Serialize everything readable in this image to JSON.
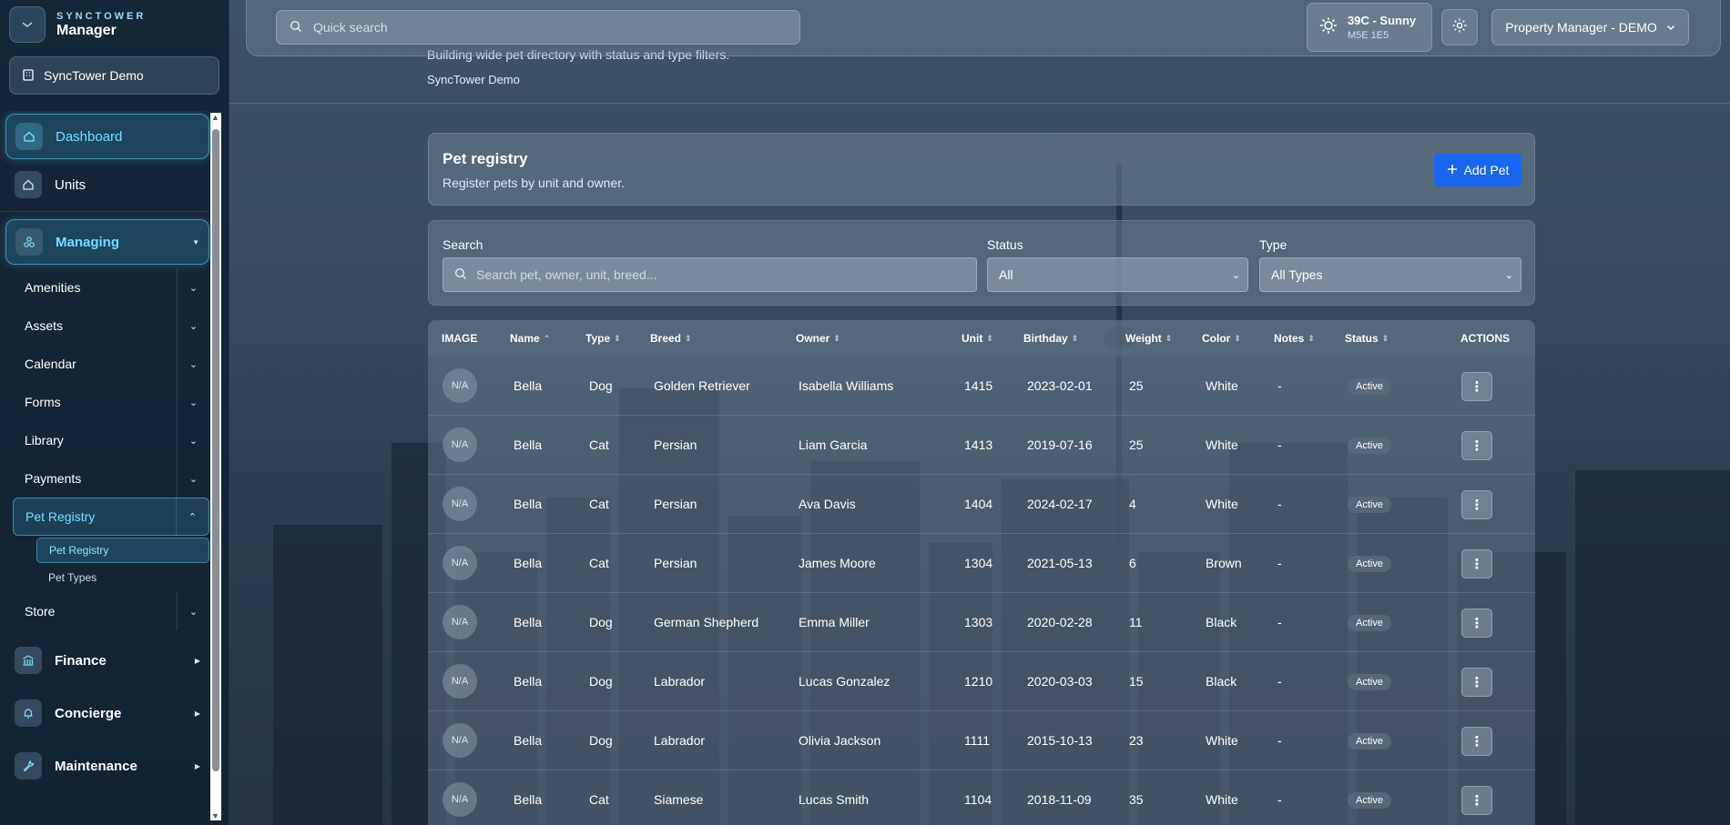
{
  "brand": {
    "top": "SYNCTOWER",
    "name": "Manager"
  },
  "org_button": "SyncTower Demo",
  "nav": {
    "dashboard": "Dashboard",
    "units": "Units",
    "managing": "Managing",
    "managing_items": [
      "Amenities",
      "Assets",
      "Calendar",
      "Forms",
      "Library",
      "Payments"
    ],
    "pet_registry": "Pet Registry",
    "pet_registry_sub": [
      "Pet Registry",
      "Pet Types"
    ],
    "store": "Store",
    "finance": "Finance",
    "concierge": "Concierge",
    "maintenance": "Maintenance"
  },
  "topbar": {
    "search_placeholder": "Quick search",
    "weather_main": "39C - Sunny",
    "weather_sub": "M5E 1E5",
    "role": "Property Manager - DEMO"
  },
  "page": {
    "subtitle": "Building wide pet directory with status and type filters.",
    "org": "SyncTower Demo"
  },
  "registry": {
    "title": "Pet registry",
    "description": "Register pets by unit and owner.",
    "add_label": "Add Pet"
  },
  "filters": {
    "search_label": "Search",
    "search_placeholder": "Search pet, owner, unit, breed...",
    "status_label": "Status",
    "status_value": "All",
    "type_label": "Type",
    "type_value": "All Types"
  },
  "table": {
    "headers": {
      "image": "IMAGE",
      "name": "Name",
      "type": "Type",
      "breed": "Breed",
      "owner": "Owner",
      "unit": "Unit",
      "birthday": "Birthday",
      "weight": "Weight",
      "color": "Color",
      "notes": "Notes",
      "status": "Status",
      "actions": "ACTIONS"
    },
    "rows": [
      {
        "img": "N/A",
        "name": "Bella",
        "type": "Dog",
        "breed": "Golden Retriever",
        "owner": "Isabella Williams",
        "unit": "1415",
        "birthday": "2023-02-01",
        "weight": "25",
        "color": "White",
        "notes": "-",
        "status": "Active"
      },
      {
        "img": "N/A",
        "name": "Bella",
        "type": "Cat",
        "breed": "Persian",
        "owner": "Liam Garcia",
        "unit": "1413",
        "birthday": "2019-07-16",
        "weight": "25",
        "color": "White",
        "notes": "-",
        "status": "Active"
      },
      {
        "img": "N/A",
        "name": "Bella",
        "type": "Cat",
        "breed": "Persian",
        "owner": "Ava Davis",
        "unit": "1404",
        "birthday": "2024-02-17",
        "weight": "4",
        "color": "White",
        "notes": "-",
        "status": "Active"
      },
      {
        "img": "N/A",
        "name": "Bella",
        "type": "Cat",
        "breed": "Persian",
        "owner": "James Moore",
        "unit": "1304",
        "birthday": "2021-05-13",
        "weight": "6",
        "color": "Brown",
        "notes": "-",
        "status": "Active"
      },
      {
        "img": "N/A",
        "name": "Bella",
        "type": "Dog",
        "breed": "German Shepherd",
        "owner": "Emma Miller",
        "unit": "1303",
        "birthday": "2020-02-28",
        "weight": "11",
        "color": "Black",
        "notes": "-",
        "status": "Active"
      },
      {
        "img": "N/A",
        "name": "Bella",
        "type": "Dog",
        "breed": "Labrador",
        "owner": "Lucas Gonzalez",
        "unit": "1210",
        "birthday": "2020-03-03",
        "weight": "15",
        "color": "Black",
        "notes": "-",
        "status": "Active"
      },
      {
        "img": "N/A",
        "name": "Bella",
        "type": "Dog",
        "breed": "Labrador",
        "owner": "Olivia Jackson",
        "unit": "1111",
        "birthday": "2015-10-13",
        "weight": "23",
        "color": "White",
        "notes": "-",
        "status": "Active"
      },
      {
        "img": "N/A",
        "name": "Bella",
        "type": "Cat",
        "breed": "Siamese",
        "owner": "Lucas Smith",
        "unit": "1104",
        "birthday": "2018-11-09",
        "weight": "35",
        "color": "White",
        "notes": "-",
        "status": "Active"
      }
    ]
  },
  "colors": {
    "accent": "#6fe0ff",
    "primary_button": "#1866f0",
    "sidebar_bg": "#122232"
  }
}
